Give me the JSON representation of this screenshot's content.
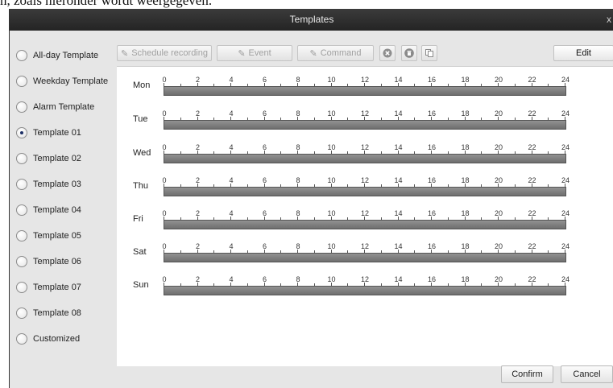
{
  "background_text": "n, zoals hieronder wordt weergegeven.",
  "window": {
    "title": "Templates",
    "close_glyph": "x"
  },
  "templates": [
    {
      "label": "All-day Template",
      "selected": false
    },
    {
      "label": "Weekday Template",
      "selected": false
    },
    {
      "label": "Alarm Template",
      "selected": false
    },
    {
      "label": "Template 01",
      "selected": true
    },
    {
      "label": "Template 02",
      "selected": false
    },
    {
      "label": "Template 03",
      "selected": false
    },
    {
      "label": "Template 04",
      "selected": false
    },
    {
      "label": "Template 05",
      "selected": false
    },
    {
      "label": "Template 06",
      "selected": false
    },
    {
      "label": "Template 07",
      "selected": false
    },
    {
      "label": "Template 08",
      "selected": false
    },
    {
      "label": "Customized",
      "selected": false
    }
  ],
  "toolbar": {
    "schedule_recording": "Schedule recording",
    "event": "Event",
    "command": "Command",
    "delete_icon": "delete-icon",
    "trash_icon": "trash-icon",
    "copy_icon": "copy-icon",
    "edit": "Edit"
  },
  "timeline": {
    "ticks": [
      "0",
      "2",
      "4",
      "6",
      "8",
      "10",
      "12",
      "14",
      "16",
      "18",
      "20",
      "22",
      "24"
    ]
  },
  "days": [
    "Mon",
    "Tue",
    "Wed",
    "Thu",
    "Fri",
    "Sat",
    "Sun"
  ],
  "footer": {
    "confirm": "Confirm",
    "cancel": "Cancel"
  },
  "colors": {
    "titlebar": "#2d2d2d",
    "schedule_bar": "#7f7f7f",
    "dialog_bg": "#e6e6e6"
  }
}
